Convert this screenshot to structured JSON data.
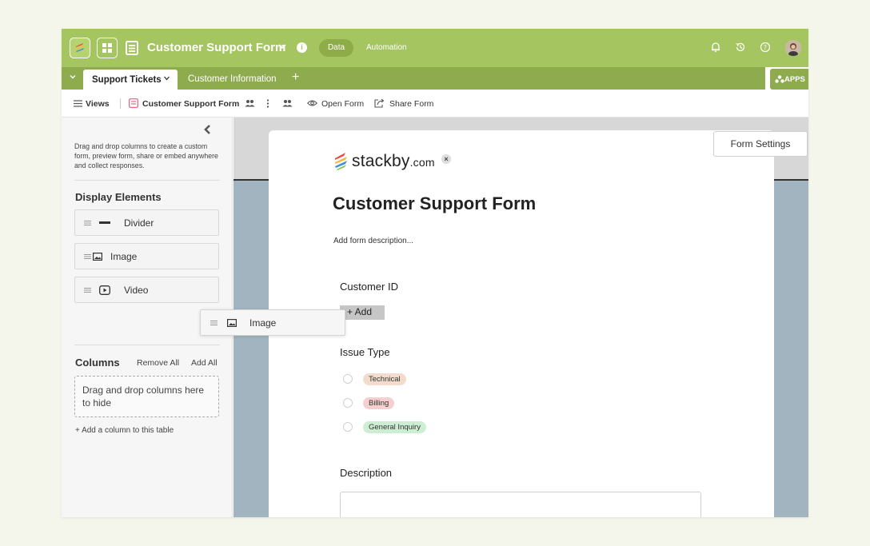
{
  "header": {
    "app_title": "Customer Support Form",
    "tabs": [
      "Data",
      "Automation"
    ],
    "icons": [
      "stackby-logo-icon",
      "grid-icon",
      "document-icon",
      "chevron-down-icon",
      "info-icon",
      "bell-icon",
      "history-icon",
      "help-icon",
      "avatar"
    ]
  },
  "tables": {
    "active": "Support Tickets",
    "other": "Customer Information",
    "add": "+",
    "apps": "APPS"
  },
  "viewbar": {
    "views": "Views",
    "view_name": "Customer Support Form",
    "open_form": "Open Form",
    "share_form": "Share Form"
  },
  "sidebar": {
    "help": "Drag and drop columns to create a custom form, preview form, share or embed anywhere and collect responses.",
    "display_title": "Display Elements",
    "elements": [
      "Divider",
      "Image",
      "Video"
    ],
    "columns_title": "Columns",
    "remove_all": "Remove All",
    "add_all": "Add All",
    "hide_zone": "Drag and drop columns here to hide",
    "add_column": "+ Add a column to this table"
  },
  "dragging": {
    "label": "Image"
  },
  "form": {
    "settings": "Form Settings",
    "brand": "stackby",
    "brand_suffix": ".com",
    "close": "×",
    "title": "Customer Support Form",
    "description": "Add form description...",
    "fields": {
      "customer_id": "Customer ID",
      "add_button": "+ Add",
      "issue_type": "Issue Type",
      "options": [
        {
          "label": "Technical",
          "color": "#f3dccb"
        },
        {
          "label": "Billing",
          "color": "#f6cfcf"
        },
        {
          "label": "General Inquiry",
          "color": "#cdeed3"
        }
      ],
      "description": "Description"
    }
  },
  "colors": {
    "brand_green": "#a4c55f",
    "tables_bar": "#8eab4e",
    "canvas": "#a1b4c0"
  }
}
